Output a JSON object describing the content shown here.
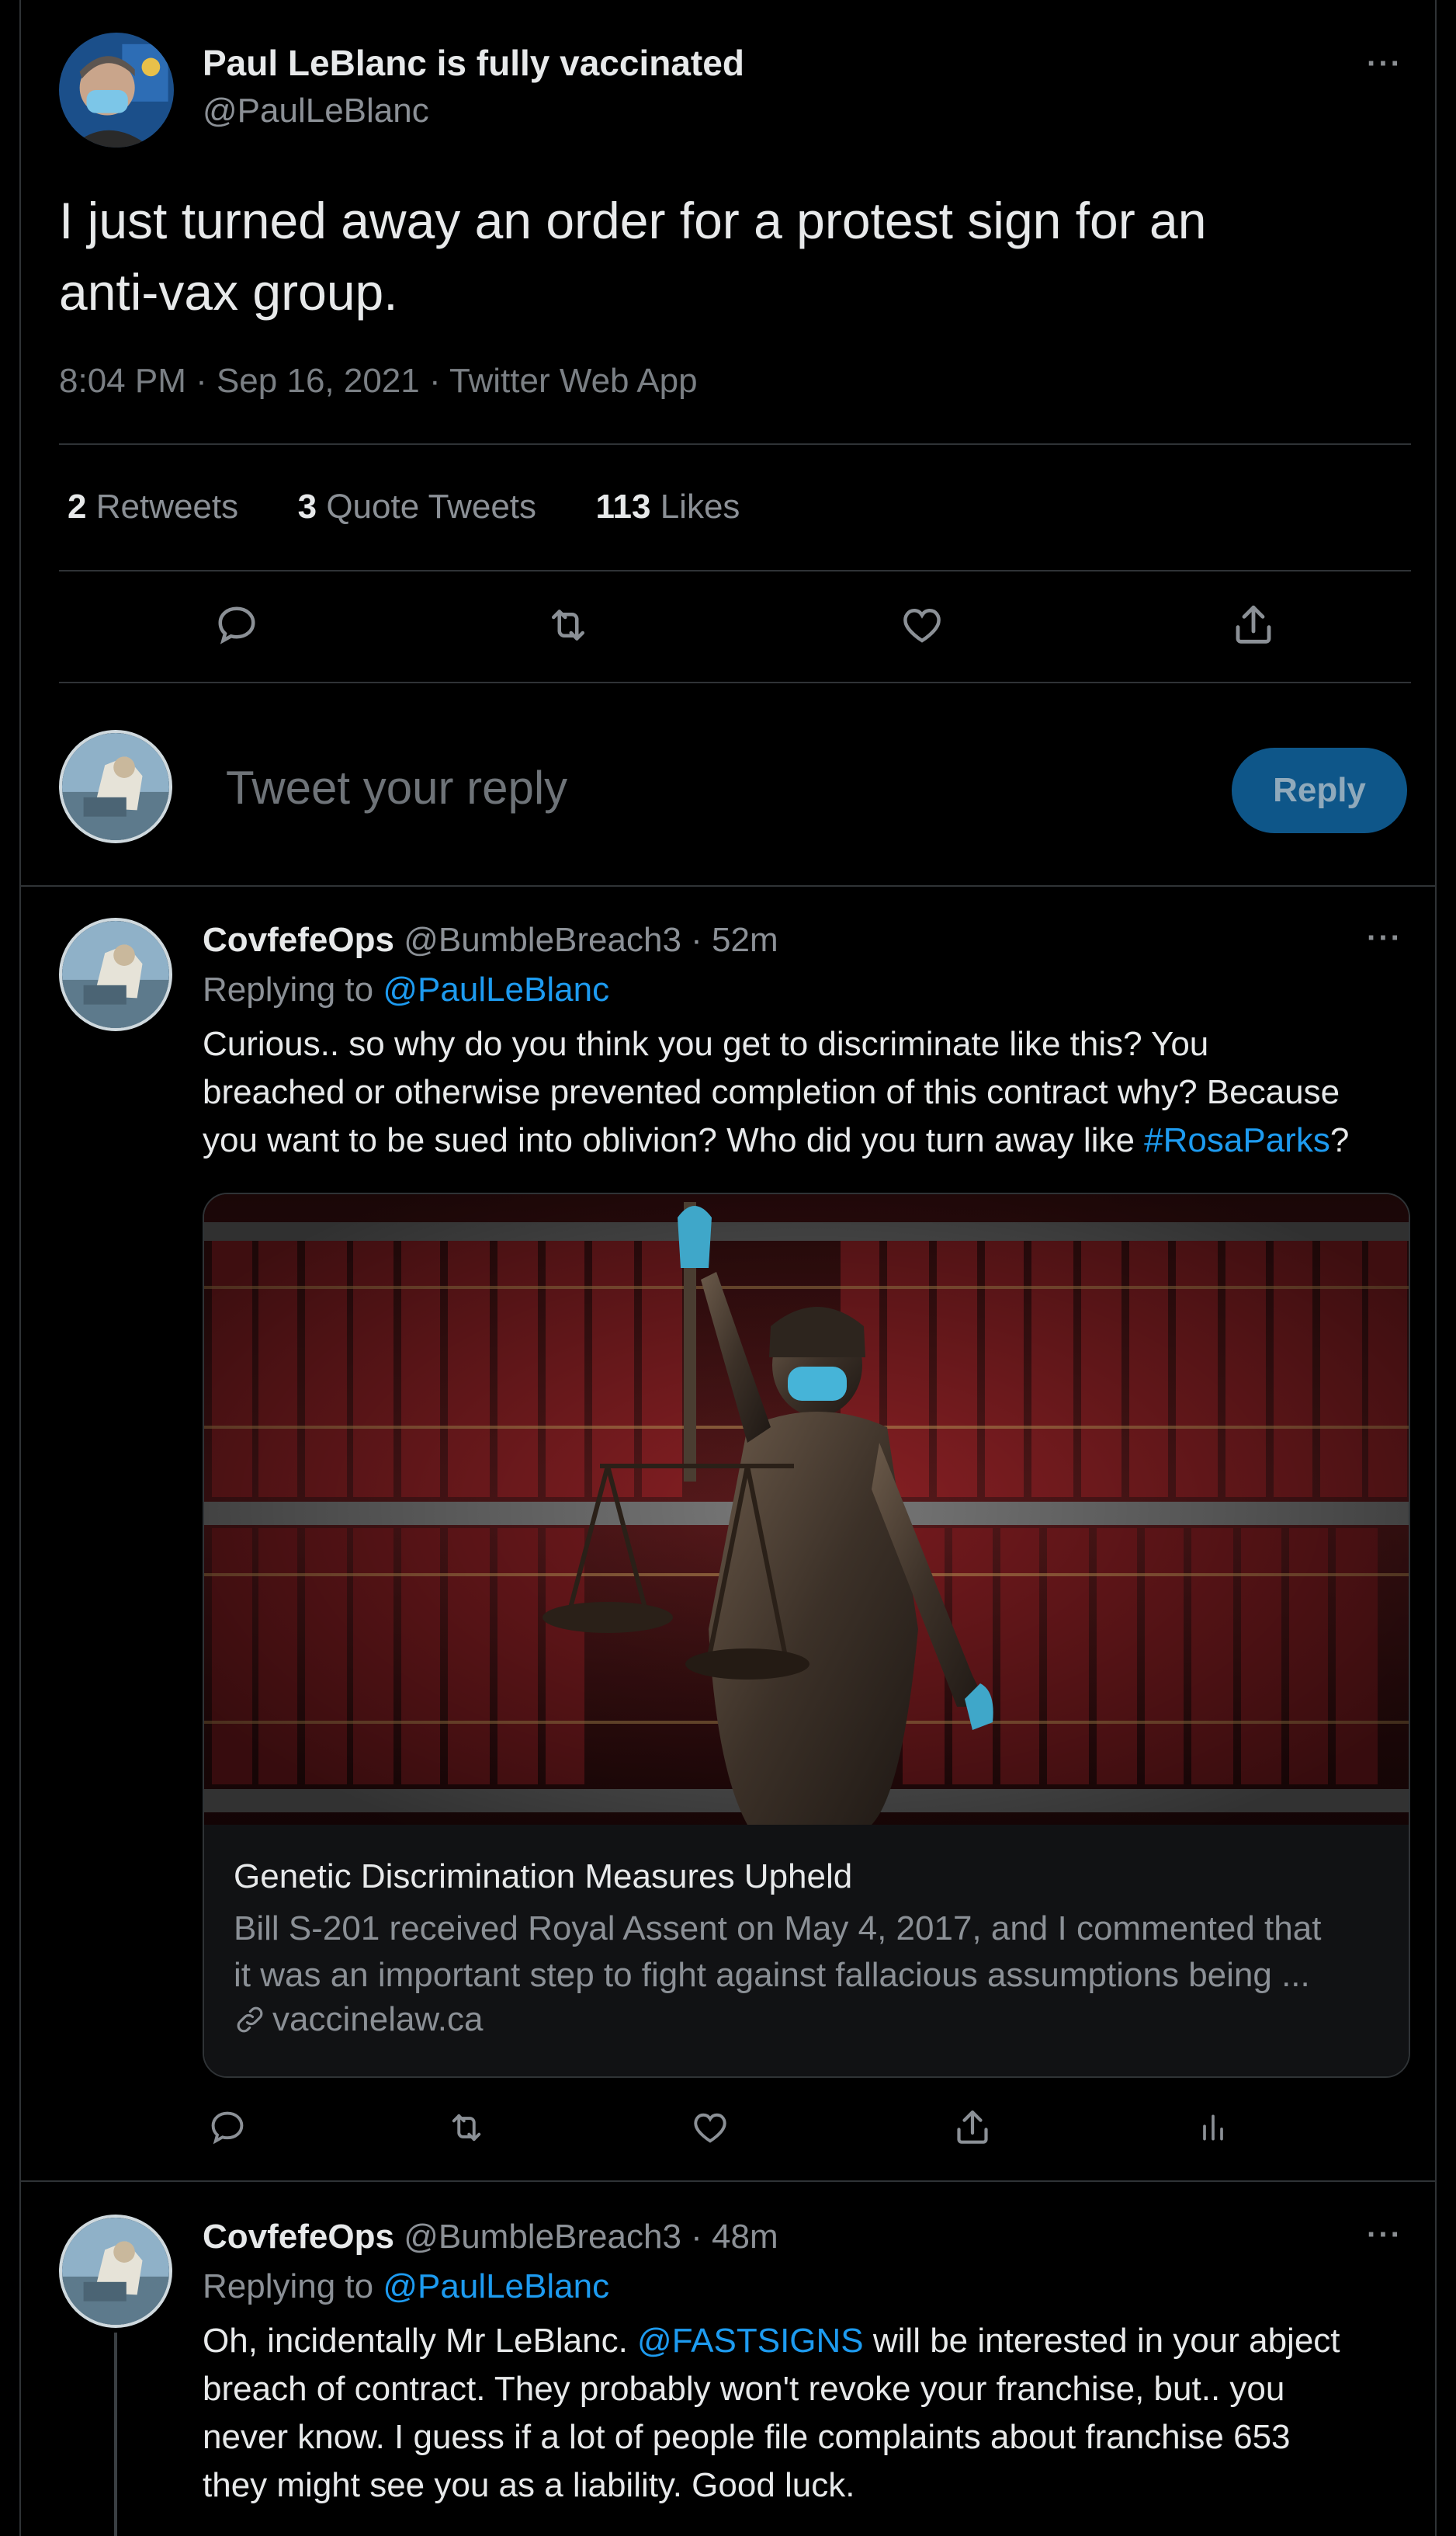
{
  "main_tweet": {
    "display_name": "Paul LeBlanc is fully vaccinated",
    "handle": "@PaulLeBlanc",
    "text_line1": "I just turned away an order for a protest sign for an",
    "text_line2": "anti-vax group.",
    "meta": "8:04 PM · Sep 16, 2021 · Twitter Web App",
    "retweets_count": "2",
    "retweets_label": "Retweets",
    "quote_count": "3",
    "quote_label": "Quote Tweets",
    "likes_count": "113",
    "likes_label": "Likes",
    "more": "···"
  },
  "composer": {
    "placeholder": "Tweet your reply",
    "reply_label": "Reply"
  },
  "reply1": {
    "display_name": "CovfefeOps",
    "handle": "@BumbleBreach3",
    "time": "· 52m",
    "replying_prefix": "Replying to ",
    "replying_to": "@PaulLeBlanc",
    "line1": "Curious.. so why do you think you get to discriminate like this? You",
    "line2": "breached or otherwise prevented completion of this contract why? Because",
    "line3_pre": "you want to be sued into oblivion? Who did you turn away like ",
    "hashtag": "#RosaParks",
    "line3_post": "?",
    "card": {
      "title": "Genetic Discrimination Measures Upheld",
      "desc_line1": "Bill S-201 received Royal Assent on May 4, 2017, and I commented that",
      "desc_line2": "it was an important step to fight against fallacious assumptions being ...",
      "domain": "vaccinelaw.ca"
    },
    "more": "···"
  },
  "reply2": {
    "display_name": "CovfefeOps",
    "handle": "@BumbleBreach3",
    "time": "· 48m",
    "replying_prefix": "Replying to ",
    "replying_to": "@PaulLeBlanc",
    "line1_pre": "Oh, incidentally Mr LeBlanc. ",
    "mention": "@FASTSIGNS",
    "line1_post": " will be interested in your abject",
    "line2": "breach of contract. They probably won't revoke your franchise, but.. you",
    "line3": "never know. I guess if a lot of people file complaints about franchise 653",
    "line4": "they might see you as a liability. Good luck.",
    "more": "···"
  },
  "colors": {
    "accent": "#1d9bf0",
    "reply_button": "#0e5689",
    "divider": "#2f3336",
    "muted": "#71767b"
  },
  "icons": [
    "comment-icon",
    "retweet-icon",
    "like-icon",
    "share-icon",
    "analytics-icon",
    "link-icon",
    "more-icon"
  ]
}
